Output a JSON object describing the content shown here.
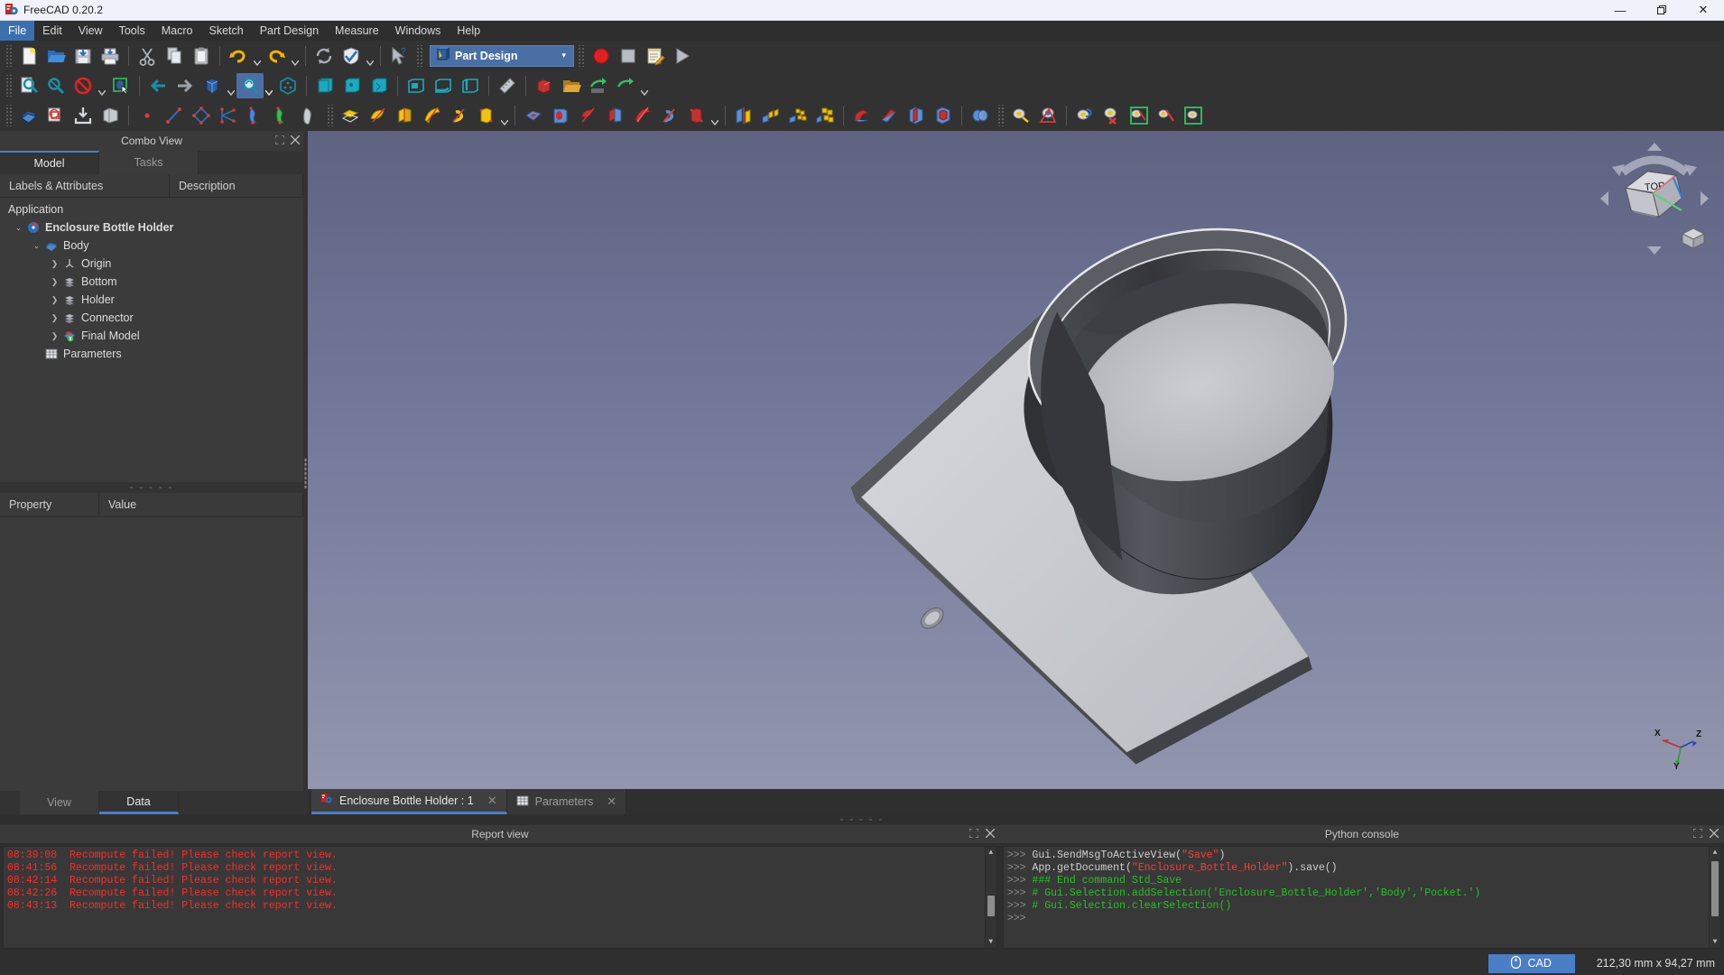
{
  "window": {
    "app_title": "FreeCAD 0.20.2",
    "logo_icon": "freecad-logo-icon",
    "minimize_label": "—",
    "maximize_label": "❐",
    "close_label": "✕"
  },
  "menubar": {
    "items": [
      {
        "label": "File",
        "active": true
      },
      {
        "label": "Edit",
        "active": false
      },
      {
        "label": "View",
        "active": false
      },
      {
        "label": "Tools",
        "active": false
      },
      {
        "label": "Macro",
        "active": false
      },
      {
        "label": "Sketch",
        "active": false
      },
      {
        "label": "Part Design",
        "active": false
      },
      {
        "label": "Measure",
        "active": false
      },
      {
        "label": "Windows",
        "active": false
      },
      {
        "label": "Help",
        "active": false
      }
    ]
  },
  "workbench": {
    "selected": "Part Design",
    "arrow": "▾",
    "icon": "part-design-workbench-icon"
  },
  "toolbars": {
    "row1": [
      "new-document-icon",
      "open-document-icon",
      "save-document-icon",
      "print-icon",
      "cut-icon",
      "copy-icon",
      "paste-icon",
      "undo-icon",
      "redo-icon",
      "refresh-icon",
      "whats-this-icon",
      "macro-record-icon",
      "macro-stop-icon",
      "macro-edit-icon",
      "macro-execute-icon"
    ],
    "row2": [
      "fit-all-icon",
      "fit-selection-icon",
      "no-draw-style-icon",
      "select-box-icon",
      "previous-view-icon",
      "next-view-icon",
      "axonometric-view-icon",
      "zoom-view-icon",
      "isometric-view-icon",
      "front-view-icon",
      "top-view-icon",
      "right-view-icon",
      "rear-view-icon",
      "bottom-view-icon",
      "left-view-icon",
      "measure-icon",
      "link-make-icon",
      "folder-icon",
      "export-link-icon",
      "link-actions-icon"
    ],
    "row3": [
      "create-body-icon",
      "create-sketch-icon",
      "attach-sketch-icon",
      "map-sketch-icon",
      "create-point-icon",
      "create-line-icon",
      "create-polyline-icon",
      "create-arc-icon",
      "additive-shape-icon",
      "additive-loft-icon",
      "additive-pipe-icon",
      "pad-icon",
      "revolution-icon",
      "additive-loft2-icon",
      "additive-pipe2-icon",
      "additive-helix-icon",
      "additive-primitive-icon",
      "pocket-icon",
      "hole-icon",
      "groove-icon",
      "subtractive-loft-icon",
      "subtractive-pipe-icon",
      "subtractive-helix-icon",
      "subtractive-primitive-icon",
      "mirrored-icon",
      "linear-pattern-icon",
      "polar-pattern-icon",
      "multi-transform-icon",
      "fillet-icon",
      "chamfer-icon",
      "draft-icon",
      "thickness-icon",
      "boolean-icon",
      "measure-linear-icon",
      "measure-angular-icon",
      "measure-refresh-icon",
      "measure-delete-icon",
      "measure-toggle-all-icon",
      "measure-toggle-3d-icon",
      "measure-toggle-delta-icon"
    ]
  },
  "combo_view": {
    "title": "Combo View",
    "float_icon": "float-icon",
    "close_icon": "close-icon",
    "tabs": [
      {
        "label": "Model",
        "active": true
      },
      {
        "label": "Tasks",
        "active": false
      }
    ],
    "columns": [
      "Labels & Attributes",
      "Description"
    ],
    "tree": [
      {
        "label": "Application",
        "depth": 0,
        "expander": "",
        "icon": "",
        "bold": false
      },
      {
        "label": "Enclosure Bottle Holder",
        "depth": 1,
        "expander": "⌄",
        "icon": "document-icon",
        "bold": true
      },
      {
        "label": "Body",
        "depth": 2,
        "expander": "⌄",
        "icon": "body-icon",
        "bold": false
      },
      {
        "label": "Origin",
        "depth": 3,
        "expander": "❯",
        "icon": "origin-icon",
        "bold": false
      },
      {
        "label": "Bottom",
        "depth": 3,
        "expander": "❯",
        "icon": "feature-icon",
        "bold": false
      },
      {
        "label": "Holder",
        "depth": 3,
        "expander": "❯",
        "icon": "feature-icon",
        "bold": false
      },
      {
        "label": "Connector",
        "depth": 3,
        "expander": "❯",
        "icon": "feature-icon",
        "bold": false
      },
      {
        "label": "Final Model",
        "depth": 3,
        "expander": "❯",
        "icon": "final-feature-icon",
        "bold": false
      },
      {
        "label": "Parameters",
        "depth": 2,
        "expander": "",
        "icon": "spreadsheet-icon",
        "bold": false
      }
    ],
    "splitter_dots": "- - - - -",
    "property_columns": [
      "Property",
      "Value"
    ],
    "bottom_tabs": [
      {
        "label": "View",
        "active": false
      },
      {
        "label": "Data",
        "active": true
      }
    ]
  },
  "view_tabs": [
    {
      "label": "Enclosure Bottle Holder : 1",
      "icon": "freecad-doc-icon",
      "active": true,
      "close": "✕"
    },
    {
      "label": "Parameters",
      "icon": "spreadsheet-icon",
      "active": false,
      "close": "✕"
    }
  ],
  "viewport": {
    "nav_cube_icon": "navigation-cube",
    "axis_labels": {
      "x": "X",
      "y": "Y",
      "z": "Z"
    },
    "splitter_dots": "- - - - -"
  },
  "report_view": {
    "title": "Report view",
    "float_icon": "float-icon",
    "close_icon": "close-icon",
    "lines": [
      {
        "time": "08:39:08",
        "text": "Recompute failed! Please check report view."
      },
      {
        "time": "08:41:56",
        "text": "Recompute failed! Please check report view."
      },
      {
        "time": "08:42:14",
        "text": "Recompute failed! Please check report view."
      },
      {
        "time": "08:42:26",
        "text": "Recompute failed! Please check report view."
      },
      {
        "time": "08:43:13",
        "text": "Recompute failed! Please check report view."
      }
    ]
  },
  "python_console": {
    "title": "Python console",
    "float_icon": "float-icon",
    "close_icon": "close-icon",
    "lines": [
      {
        "prompt": ">>> ",
        "segments": [
          {
            "t": "Gui.SendMsgToActiveView(",
            "c": "plain"
          },
          {
            "t": "\"Save\"",
            "c": "str"
          },
          {
            "t": ")",
            "c": "plain"
          }
        ]
      },
      {
        "prompt": ">>> ",
        "segments": [
          {
            "t": "App.getDocument(",
            "c": "plain"
          },
          {
            "t": "\"Enclosure_Bottle_Holder\"",
            "c": "str"
          },
          {
            "t": ").save()",
            "c": "plain"
          }
        ]
      },
      {
        "prompt": ">>> ",
        "segments": [
          {
            "t": "### End command Std_Save",
            "c": "cmt"
          }
        ]
      },
      {
        "prompt": ">>> ",
        "segments": [
          {
            "t": "# Gui.Selection.addSelection('Enclosure_Bottle_Holder','Body','Pocket.')",
            "c": "cmt"
          }
        ]
      },
      {
        "prompt": ">>> ",
        "segments": [
          {
            "t": "# Gui.Selection.clearSelection()",
            "c": "cmt"
          }
        ]
      },
      {
        "prompt": ">>> ",
        "segments": []
      }
    ]
  },
  "statusbar": {
    "cad_badge": "CAD",
    "cad_icon": "mouse-icon",
    "dimensions": "212,30 mm x 94,27 mm"
  },
  "colors": {
    "accent": "#4a7ec7",
    "menu_active": "#3c6fb0",
    "error_text": "#ff2a2a",
    "comment_text": "#22c322",
    "string_text": "#ff3a3a",
    "panel_bg": "#333333",
    "toolbar_bg": "#323232",
    "viewport_top": "#5f6382",
    "viewport_bottom": "#9396ae",
    "model_light": "#c9cbd0",
    "model_dark": "#4e5055"
  }
}
